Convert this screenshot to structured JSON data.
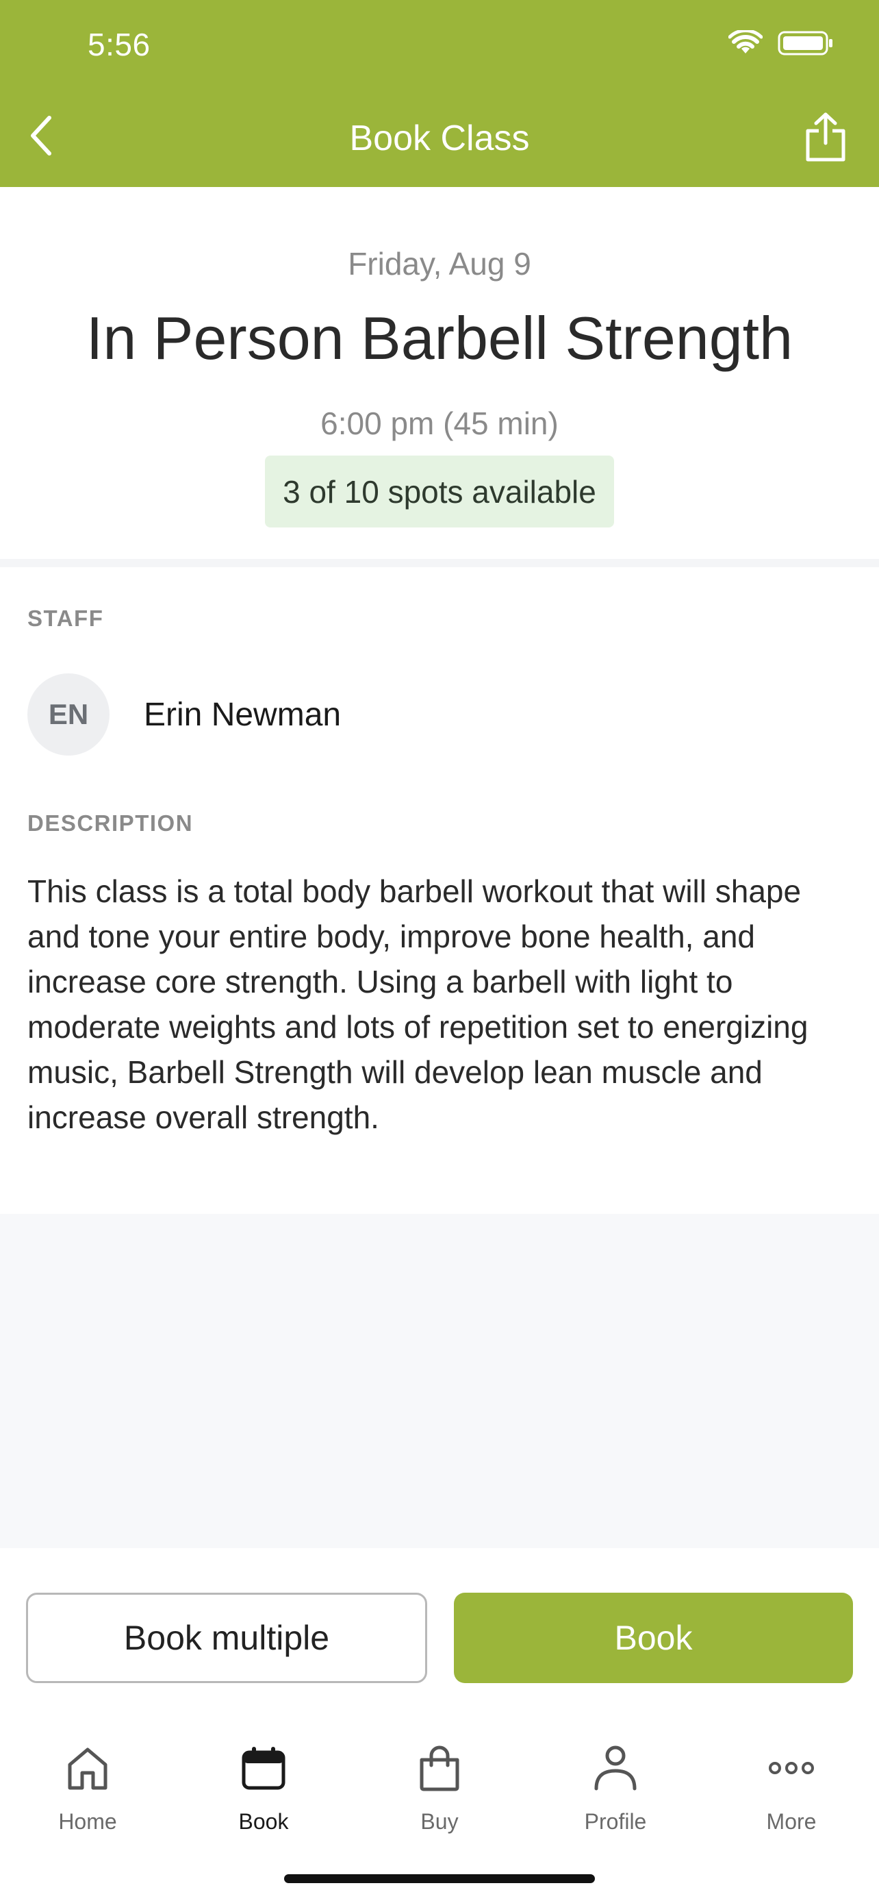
{
  "status_bar": {
    "time": "5:56"
  },
  "nav": {
    "title": "Book Class"
  },
  "class": {
    "date": "Friday, Aug 9",
    "name": "In Person Barbell Strength",
    "time": "6:00 pm (45 min)",
    "spots": "3 of 10 spots available"
  },
  "staff": {
    "label": "STAFF",
    "initials": "EN",
    "name": "Erin Newman"
  },
  "description": {
    "label": "DESCRIPTION",
    "text": "This class is a total body barbell workout that will shape and tone your entire body, improve bone health, and increase core strength. Using a barbell with light to moderate weights and lots of repetition set to energizing music, Barbell Strength will develop lean muscle and increase overall strength."
  },
  "actions": {
    "book_multiple": "Book multiple",
    "book": "Book"
  },
  "tabs": [
    {
      "label": "Home",
      "icon": "home-icon"
    },
    {
      "label": "Book",
      "icon": "calendar-icon",
      "active": true
    },
    {
      "label": "Buy",
      "icon": "shopping-bag-icon"
    },
    {
      "label": "Profile",
      "icon": "person-icon"
    },
    {
      "label": "More",
      "icon": "more-dots-icon"
    }
  ],
  "colors": {
    "brand": "#9bb53a",
    "badge_bg": "#e5f3e2"
  }
}
